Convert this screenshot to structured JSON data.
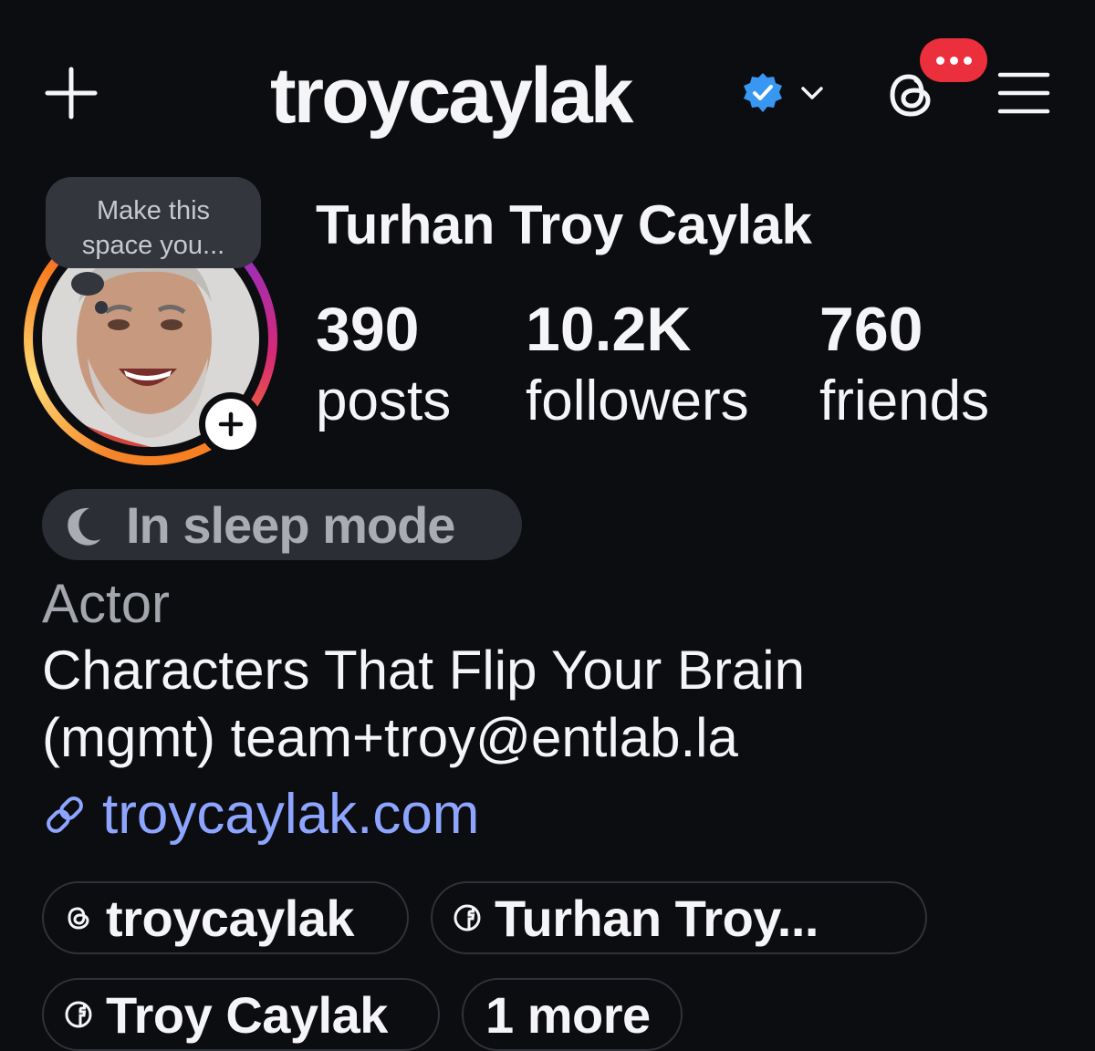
{
  "header": {
    "username": "troycaylak",
    "verified": true,
    "notification_dots": "..."
  },
  "note": {
    "text_line1": "Make this",
    "text_line2": "space you..."
  },
  "profile": {
    "full_name": "Turhan Troy Caylak",
    "stats": {
      "posts": {
        "value": "390",
        "label": "posts"
      },
      "followers": {
        "value": "10.2K",
        "label": "followers"
      },
      "friends": {
        "value": "760",
        "label": "friends"
      }
    },
    "status": "In sleep mode",
    "category": "Actor",
    "bio_line1": "Characters That Flip Your Brain",
    "bio_line2": "(mgmt) team+troy@entlab.la",
    "website": "troycaylak.com"
  },
  "chips": [
    {
      "icon": "threads-icon",
      "label": "troycaylak"
    },
    {
      "icon": "facebook-icon",
      "label": "Turhan Troy..."
    },
    {
      "icon": "facebook-icon",
      "label": "Troy Caylak"
    },
    {
      "icon": "",
      "label": "1 more"
    }
  ],
  "colors": {
    "background": "#0c0d10",
    "verified_badge": "#3897f0",
    "notification_badge": "#ec2f3c",
    "link": "#8ea5ff",
    "pill_background": "#2b2e34"
  }
}
